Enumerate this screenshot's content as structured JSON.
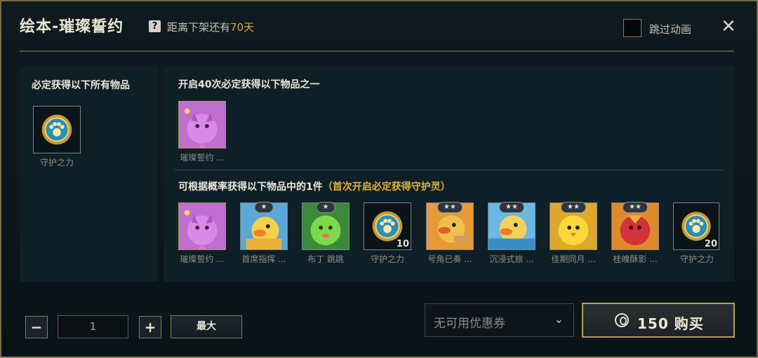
{
  "window": {
    "title": "绘本-璀璨誓约",
    "countdown_prefix": "距离下架还有",
    "countdown_value": "70天",
    "skip_label": "跳过动画"
  },
  "left_section": {
    "heading": "必定获得以下所有物品",
    "items": [
      {
        "label": "守护之力",
        "icon": "paw-medal-icon"
      }
    ]
  },
  "right_section": {
    "heading_top": "开启40次必定获得以下物品之一",
    "top_items": [
      {
        "label": "璀璨誓约 ...",
        "icon": "purple-mascot-icon"
      }
    ],
    "heading_prob": "可根据概率获得以下物品中的1件",
    "heading_prob_note": "（首次开启必定获得守护灵）",
    "prob_items": [
      {
        "label": "璀璨誓约 ...",
        "stars": "",
        "qty": "",
        "icon": "purple-mascot-icon"
      },
      {
        "label": "首席指挥 ...",
        "stars": "★",
        "qty": "",
        "icon": "yellow-duck-icon"
      },
      {
        "label": "布丁 跳跳",
        "stars": "★",
        "qty": "",
        "icon": "green-blob-icon"
      },
      {
        "label": "守护之力",
        "stars": "",
        "qty": "10",
        "icon": "paw-medal-icon"
      },
      {
        "label": "号角已奏 ...",
        "stars": "★★",
        "qty": "",
        "icon": "duck-trumpet-icon"
      },
      {
        "label": "沉浸式旅 ...",
        "stars": "★★",
        "qty": "",
        "icon": "duck-blue-icon"
      },
      {
        "label": "佳期同月 ...",
        "stars": "★★",
        "qty": "",
        "icon": "yellow-chick-icon"
      },
      {
        "label": "桂魄酥影 ...",
        "stars": "★★",
        "qty": "",
        "icon": "red-bird-icon"
      },
      {
        "label": "守护之力",
        "stars": "",
        "qty": "20",
        "icon": "paw-medal-icon"
      }
    ]
  },
  "footer": {
    "minus": "−",
    "quantity": "1",
    "plus": "+",
    "max_label": "最大",
    "coupon_placeholder": "无可用优惠券",
    "buy_price": "150",
    "buy_label": "购买"
  },
  "colors": {
    "accent_gold": "#d9a83a",
    "frame_gold": "#8d7a4e",
    "panel_bg": "#0f1f27"
  }
}
